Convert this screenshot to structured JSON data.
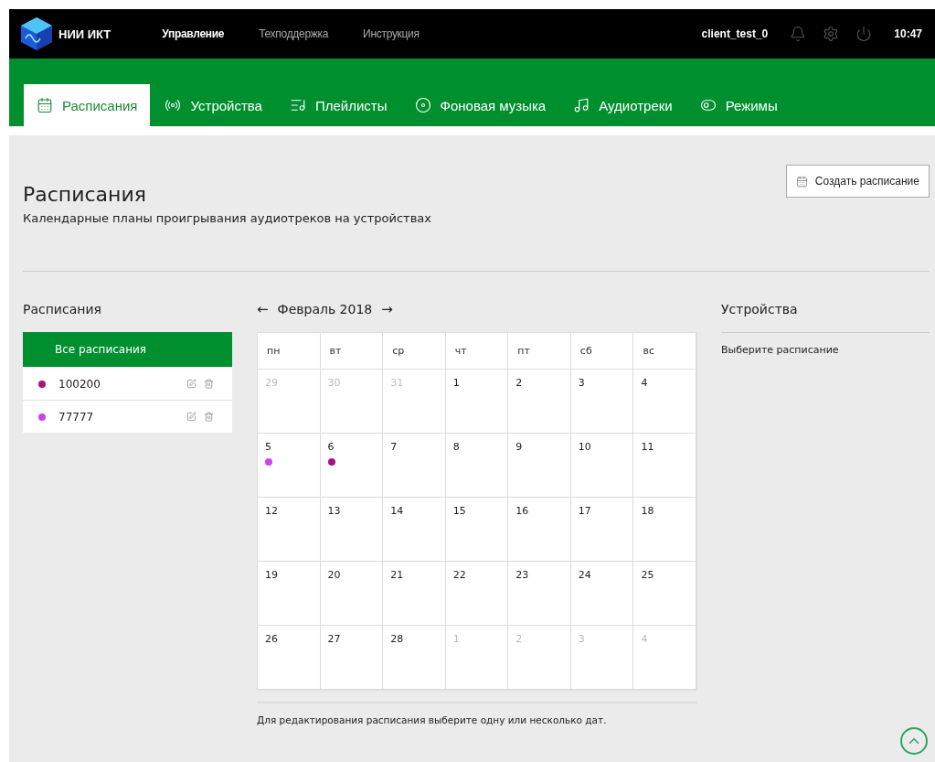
{
  "header": {
    "logo_text": "НИИ ИКТ",
    "nav": [
      {
        "label": "Управление",
        "selected": true
      },
      {
        "label": "Техподдержка",
        "selected": false
      },
      {
        "label": "Инструкция",
        "selected": false
      }
    ],
    "user": "client_test_0",
    "time": "10:47"
  },
  "tabs": [
    {
      "label": "Расписания",
      "kind": "calendar",
      "selected": true
    },
    {
      "label": "Устройства",
      "kind": "radio",
      "selected": false
    },
    {
      "label": "Плейлисты",
      "kind": "playlist",
      "selected": false
    },
    {
      "label": "Фоновая музыка",
      "kind": "disc",
      "selected": false
    },
    {
      "label": "Аудиотреки",
      "kind": "music",
      "selected": false
    },
    {
      "label": "Режимы",
      "kind": "toggle",
      "selected": false
    }
  ],
  "page": {
    "title": "Расписания",
    "subtitle": "Календарные планы проигрывания аудиотреков на устройствах",
    "create_button": "Создать расписание"
  },
  "schedules": {
    "title": "Расписания",
    "all_label": "Все расписания",
    "all_selected": true,
    "items": [
      {
        "name": "100200",
        "color": "#a8127f"
      },
      {
        "name": "77777",
        "color": "#cc44ee"
      }
    ]
  },
  "calendar": {
    "month": "Февраль 2018",
    "prev": "←",
    "next": "→",
    "weekdays": [
      "пн",
      "вт",
      "ср",
      "чт",
      "пт",
      "сб",
      "вс"
    ],
    "weeks": [
      [
        {
          "day": "29",
          "in_month": false
        },
        {
          "day": "30",
          "in_month": false
        },
        {
          "day": "31",
          "in_month": false
        },
        {
          "day": "1",
          "in_month": true
        },
        {
          "day": "2",
          "in_month": true
        },
        {
          "day": "3",
          "in_month": true
        },
        {
          "day": "4",
          "in_month": true
        }
      ],
      [
        {
          "day": "5",
          "in_month": true,
          "dots": [
            {
              "color": "#cc44ee"
            }
          ]
        },
        {
          "day": "6",
          "in_month": true,
          "dots": [
            {
              "color": "#a8127f"
            }
          ]
        },
        {
          "day": "7",
          "in_month": true
        },
        {
          "day": "8",
          "in_month": true
        },
        {
          "day": "9",
          "in_month": true
        },
        {
          "day": "10",
          "in_month": true
        },
        {
          "day": "11",
          "in_month": true
        }
      ],
      [
        {
          "day": "12",
          "in_month": true
        },
        {
          "day": "13",
          "in_month": true
        },
        {
          "day": "14",
          "in_month": true
        },
        {
          "day": "15",
          "in_month": true
        },
        {
          "day": "16",
          "in_month": true
        },
        {
          "day": "17",
          "in_month": true
        },
        {
          "day": "18",
          "in_month": true
        }
      ],
      [
        {
          "day": "19",
          "in_month": true
        },
        {
          "day": "20",
          "in_month": true
        },
        {
          "day": "21",
          "in_month": true
        },
        {
          "day": "22",
          "in_month": true
        },
        {
          "day": "23",
          "in_month": true
        },
        {
          "day": "24",
          "in_month": true
        },
        {
          "day": "25",
          "in_month": true
        }
      ],
      [
        {
          "day": "26",
          "in_month": true
        },
        {
          "day": "27",
          "in_month": true
        },
        {
          "day": "28",
          "in_month": true
        },
        {
          "day": "1",
          "in_month": false
        },
        {
          "day": "2",
          "in_month": false
        },
        {
          "day": "3",
          "in_month": false
        },
        {
          "day": "4",
          "in_month": false
        }
      ]
    ],
    "hint": "Для редактирования расписания выберите одну или несколько дат."
  },
  "devices": {
    "title": "Устройства",
    "empty_text": "Выберите расписание"
  }
}
